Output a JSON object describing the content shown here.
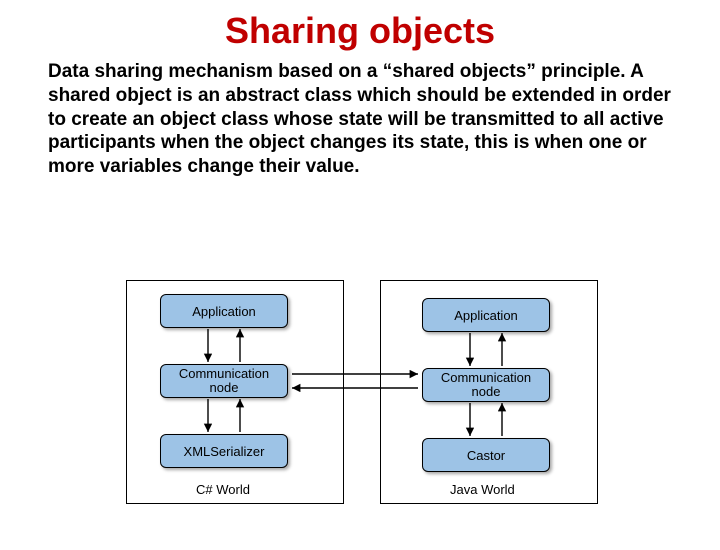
{
  "title": "Sharing objects",
  "paragraph": "Data sharing mechanism based on a “shared objects” principle. A shared object is an abstract class which should be extended in order to create an object class whose state will be transmitted to all active participants when the object changes its state, this is when one or more variables change their value.",
  "diagram": {
    "left": {
      "app": "Application",
      "comm": "Communication\nnode",
      "serializer": "XMLSerializer",
      "caption": "C# World"
    },
    "right": {
      "app": "Application",
      "comm": "Communication\nnode",
      "serializer": "Castor",
      "caption": "Java World"
    }
  }
}
